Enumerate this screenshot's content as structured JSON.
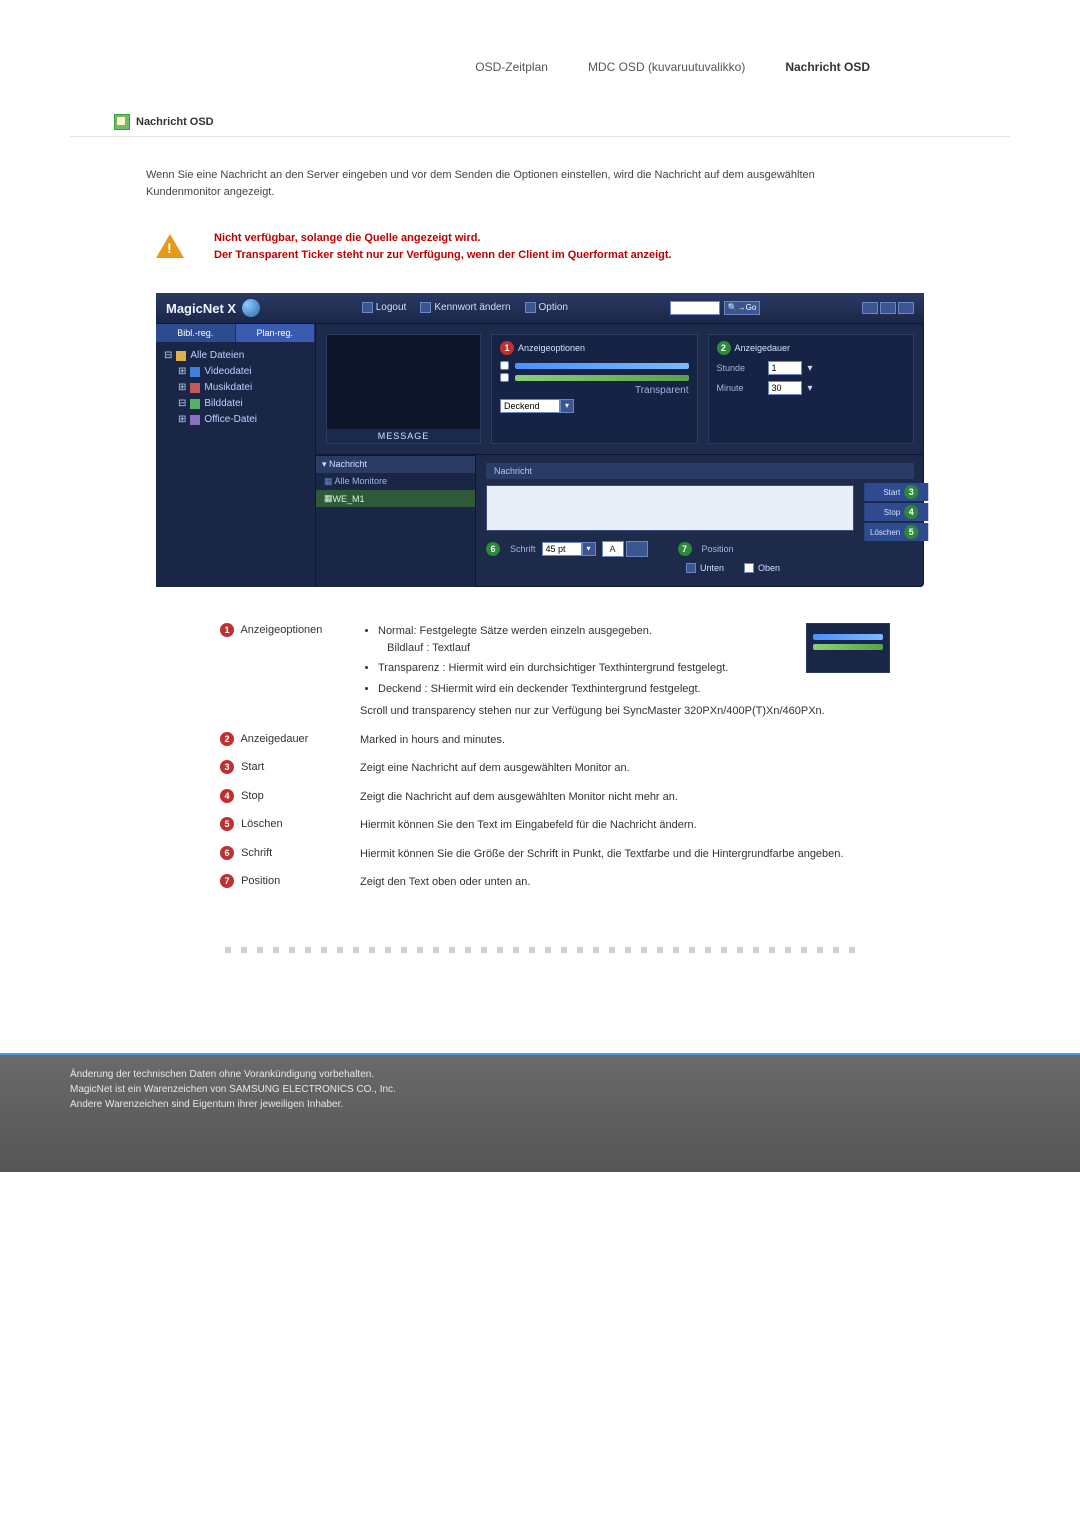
{
  "nav": {
    "item1": "OSD-Zeitplan",
    "item2": "MDC OSD (kuvaruutuvalikko)",
    "item3": "Nachricht OSD"
  },
  "section_title": "Nachricht OSD",
  "intro": "Wenn Sie eine Nachricht an den Server eingeben und vor dem Senden die Optionen einstellen, wird die Nachricht auf dem ausgewählten Kundenmonitor angezeigt.",
  "warning": {
    "line1": "Nicht verfügbar, solange die Quelle angezeigt wird.",
    "line2": "Der Transparent Ticker steht nur zur Verfügung, wenn der Client im Querformat anzeigt."
  },
  "app": {
    "brand": "MagicNet X",
    "bar": {
      "logout": "Logout",
      "pw": "Kennwort ändern",
      "option": "Option"
    },
    "search_btn": "🔍→Go",
    "tabs": {
      "left": "Bibl.-reg.",
      "right": "Plan-reg."
    },
    "tree": {
      "root": "Alle Dateien",
      "video": "Videodatei",
      "music": "Musikdatei",
      "image": "Bilddatei",
      "office": "Office-Datei"
    },
    "preview_label": "MESSAGE",
    "opt": {
      "title": "Anzeigeoptionen",
      "transparent": "Transparent",
      "deckend": "Deckend"
    },
    "dur": {
      "title": "Anzeigedauer",
      "hour_label": "Stunde",
      "hour_val": "1",
      "min_label": "Minute",
      "min_val": "30"
    },
    "side2": {
      "hdr": "▾ Nachricht",
      "item_all": "Alle Monitore",
      "item_sel": "WE_M1"
    },
    "msg": {
      "hdr": "Nachricht",
      "start": "Start",
      "stop": "Stop",
      "del": "Löschen"
    },
    "font": {
      "title": "Schrift",
      "size": "45 pt",
      "a": "A"
    },
    "pos": {
      "title": "Position",
      "bottom": "Unten",
      "top": "Oben"
    }
  },
  "legend": {
    "r1": {
      "label": "Anzeigeoptionen",
      "b1": "Normal: Festgelegte Sätze werden einzeln ausgegeben.",
      "b1sub": "Bildlauf : Textlauf",
      "b2": "Transparenz : Hiermit wird ein durchsichtiger Texthintergrund festgelegt.",
      "b3": "Deckend : SHiermit wird ein deckender Texthintergrund festgelegt.",
      "note": "Scroll und transparency stehen nur zur Verfügung bei SyncMaster 320PXn/400P(T)Xn/460PXn."
    },
    "r2": {
      "label": "Anzeigedauer",
      "desc": "Marked in hours and minutes."
    },
    "r3": {
      "label": "Start",
      "desc": "Zeigt eine Nachricht auf dem ausgewählten Monitor an."
    },
    "r4": {
      "label": "Stop",
      "desc": "Zeigt die Nachricht auf dem ausgewählten Monitor nicht mehr an."
    },
    "r5": {
      "label": "Löschen",
      "desc": "Hiermit können Sie den Text im Eingabefeld für die Nachricht ändern."
    },
    "r6": {
      "label": "Schrift",
      "desc": "Hiermit können Sie die Größe der Schrift in Punkt, die Textfarbe und die Hintergrundfarbe angeben."
    },
    "r7": {
      "label": "Position",
      "desc": "Zeigt den Text oben oder unten an."
    }
  },
  "footer": {
    "l1": "Änderung der technischen Daten ohne Vorankündigung vorbehalten.",
    "l2": "MagicNet ist ein Warenzeichen von SAMSUNG ELECTRONICS CO., Inc.",
    "l3": "Andere Warenzeichen sind Eigentum ihrer jeweiligen Inhaber."
  }
}
